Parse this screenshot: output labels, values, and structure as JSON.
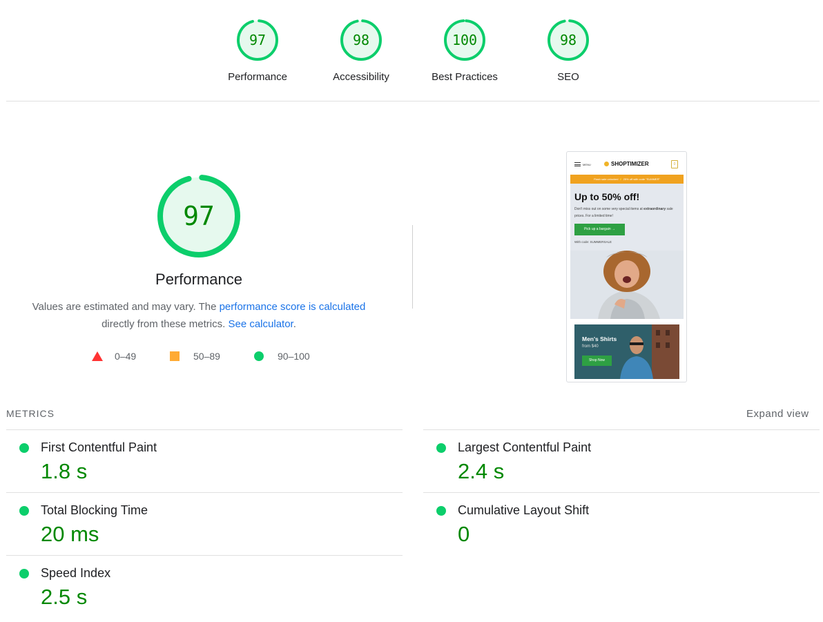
{
  "scores": [
    {
      "label": "Performance",
      "value": "97",
      "fraction": 0.97
    },
    {
      "label": "Accessibility",
      "value": "98",
      "fraction": 0.98
    },
    {
      "label": "Best Practices",
      "value": "100",
      "fraction": 1.0
    },
    {
      "label": "SEO",
      "value": "98",
      "fraction": 0.98
    }
  ],
  "performance": {
    "score": "97",
    "fraction": 0.97,
    "title": "Performance",
    "desc_text1": "Values are estimated and may vary. The ",
    "desc_link1": "performance score is calculated",
    "desc_text2": "directly from these metrics. ",
    "desc_link2": "See calculator",
    "desc_text3": "."
  },
  "legend": {
    "fail": "0–49",
    "average": "50–89",
    "pass": "90–100"
  },
  "colors": {
    "pass": "#0cce6b",
    "pass_text": "#008800",
    "average": "#ffaa33",
    "fail": "#ff3333",
    "link": "#1a73e8"
  },
  "screenshot": {
    "menu": "MENU",
    "logo": "SHOPTIMIZER",
    "cart_count": "0",
    "banner": "Flash sale unlocked ⚡ 25% off with code \"SUMMER\"",
    "hero_title": "Up to 50% off!",
    "hero_text_1": "Don't miss out on some very special items at ",
    "hero_text_bold": "extraordinary",
    "hero_text_2": " sale prices. For a limited time!",
    "hero_button": "Pick up a bargain →",
    "hero_code": "With code: SUMMERSALE",
    "card_title": "Men's Shirts",
    "card_sub": "from $40",
    "card_button": "Shop Now"
  },
  "metrics_section": {
    "label": "METRICS",
    "expand": "Expand view"
  },
  "metrics": [
    {
      "name": "First Contentful Paint",
      "value": "1.8 s"
    },
    {
      "name": "Largest Contentful Paint",
      "value": "2.4 s"
    },
    {
      "name": "Total Blocking Time",
      "value": "20 ms"
    },
    {
      "name": "Cumulative Layout Shift",
      "value": "0"
    },
    {
      "name": "Speed Index",
      "value": "2.5 s"
    }
  ]
}
